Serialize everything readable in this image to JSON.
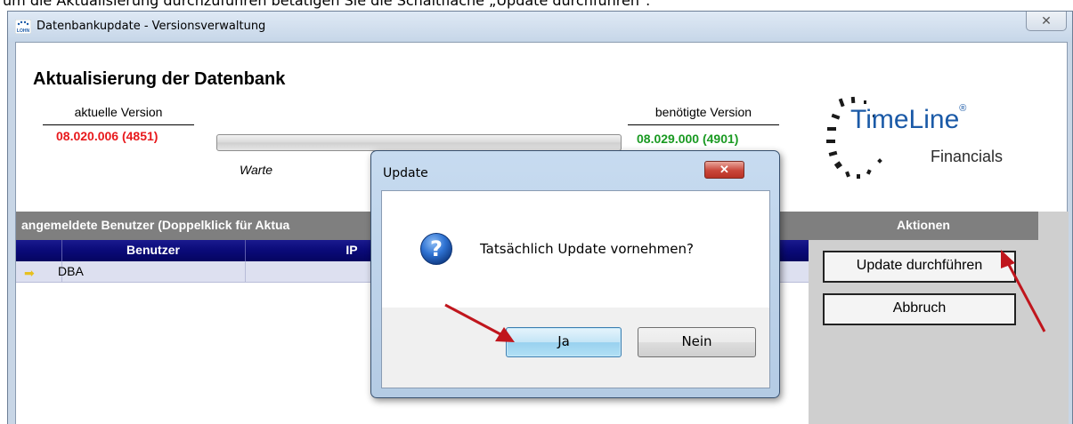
{
  "page_caption": "um die Aktualisierung durchzuführen betätigen Sie die Schaltfläche „Update durchführen“.",
  "window": {
    "title": "Datenbankupdate - Versionsverwaltung",
    "app_icon_text": "LOHN",
    "close_glyph": "✕"
  },
  "header": {
    "heading": "Aktualisierung der Datenbank",
    "current_label": "aktuelle Version",
    "current_value": "08.020.006 (4851)",
    "required_label": "benötigte Version",
    "required_value": "08.029.000 (4901)",
    "wait_text": "Warte",
    "current_color": "#e8191c",
    "required_color": "#1a9a22"
  },
  "logo": {
    "brand": "TimeLine",
    "registered": "®",
    "sub": "Financials"
  },
  "users": {
    "section_title": "angemeldete Benutzer (Doppelklick für Aktua",
    "columns": [
      "Benutzer",
      "IP"
    ],
    "rows": [
      {
        "marker": "➡",
        "user": "DBA",
        "ip": ""
      }
    ]
  },
  "actions": {
    "title": "Aktionen",
    "update_label": "Update durchführen",
    "cancel_label": "Abbruch"
  },
  "dialog": {
    "title": "Update",
    "close_glyph": "✕",
    "message": "Tatsächlich Update vornehmen?",
    "icon": "question-icon",
    "yes_label": "Ja",
    "no_label": "Nein"
  }
}
